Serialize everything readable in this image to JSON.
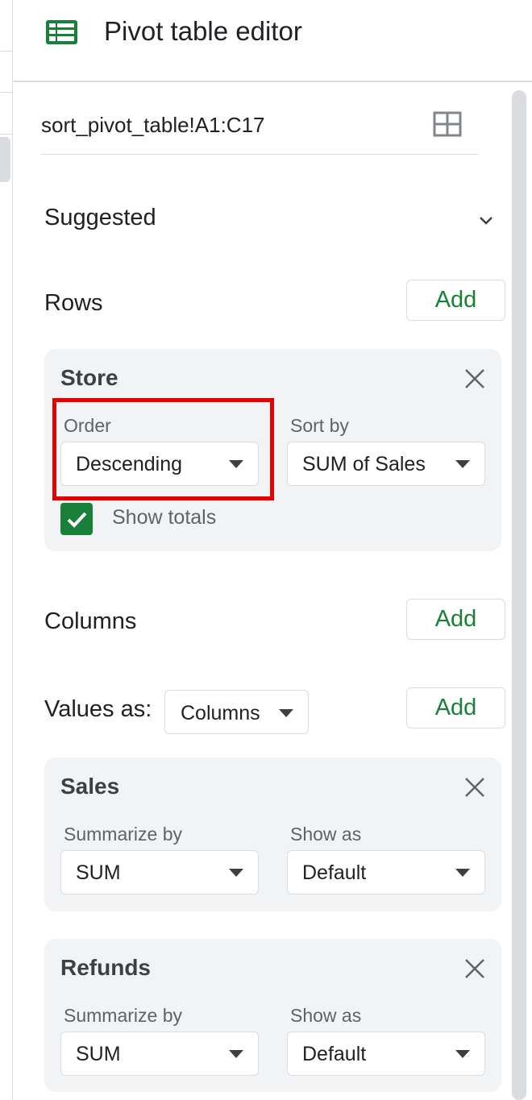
{
  "header": {
    "title": "Pivot table editor",
    "icon": "google-sheets-icon"
  },
  "range": {
    "value": "sort_pivot_table!A1:C17",
    "select_icon": "grid-icon"
  },
  "suggested": {
    "label": "Suggested",
    "icon": "chevron-down-icon"
  },
  "rows": {
    "label": "Rows",
    "add_label": "Add",
    "card": {
      "title": "Store",
      "order_label": "Order",
      "order_value": "Descending",
      "sortby_label": "Sort by",
      "sortby_value": "SUM of Sales",
      "show_totals_label": "Show totals",
      "show_totals_checked": true
    }
  },
  "columns": {
    "label": "Columns",
    "add_label": "Add"
  },
  "values": {
    "label": "Values as:",
    "values_as_value": "Columns",
    "add_label": "Add",
    "cards": [
      {
        "title": "Sales",
        "summarize_label": "Summarize by",
        "summarize_value": "SUM",
        "showas_label": "Show as",
        "showas_value": "Default"
      },
      {
        "title": "Refunds",
        "summarize_label": "Summarize by",
        "summarize_value": "SUM",
        "showas_label": "Show as",
        "showas_value": "Default"
      }
    ]
  },
  "colors": {
    "accent_green": "#188038",
    "highlight_red": "#e60000",
    "card_bg": "#f1f3f4"
  }
}
